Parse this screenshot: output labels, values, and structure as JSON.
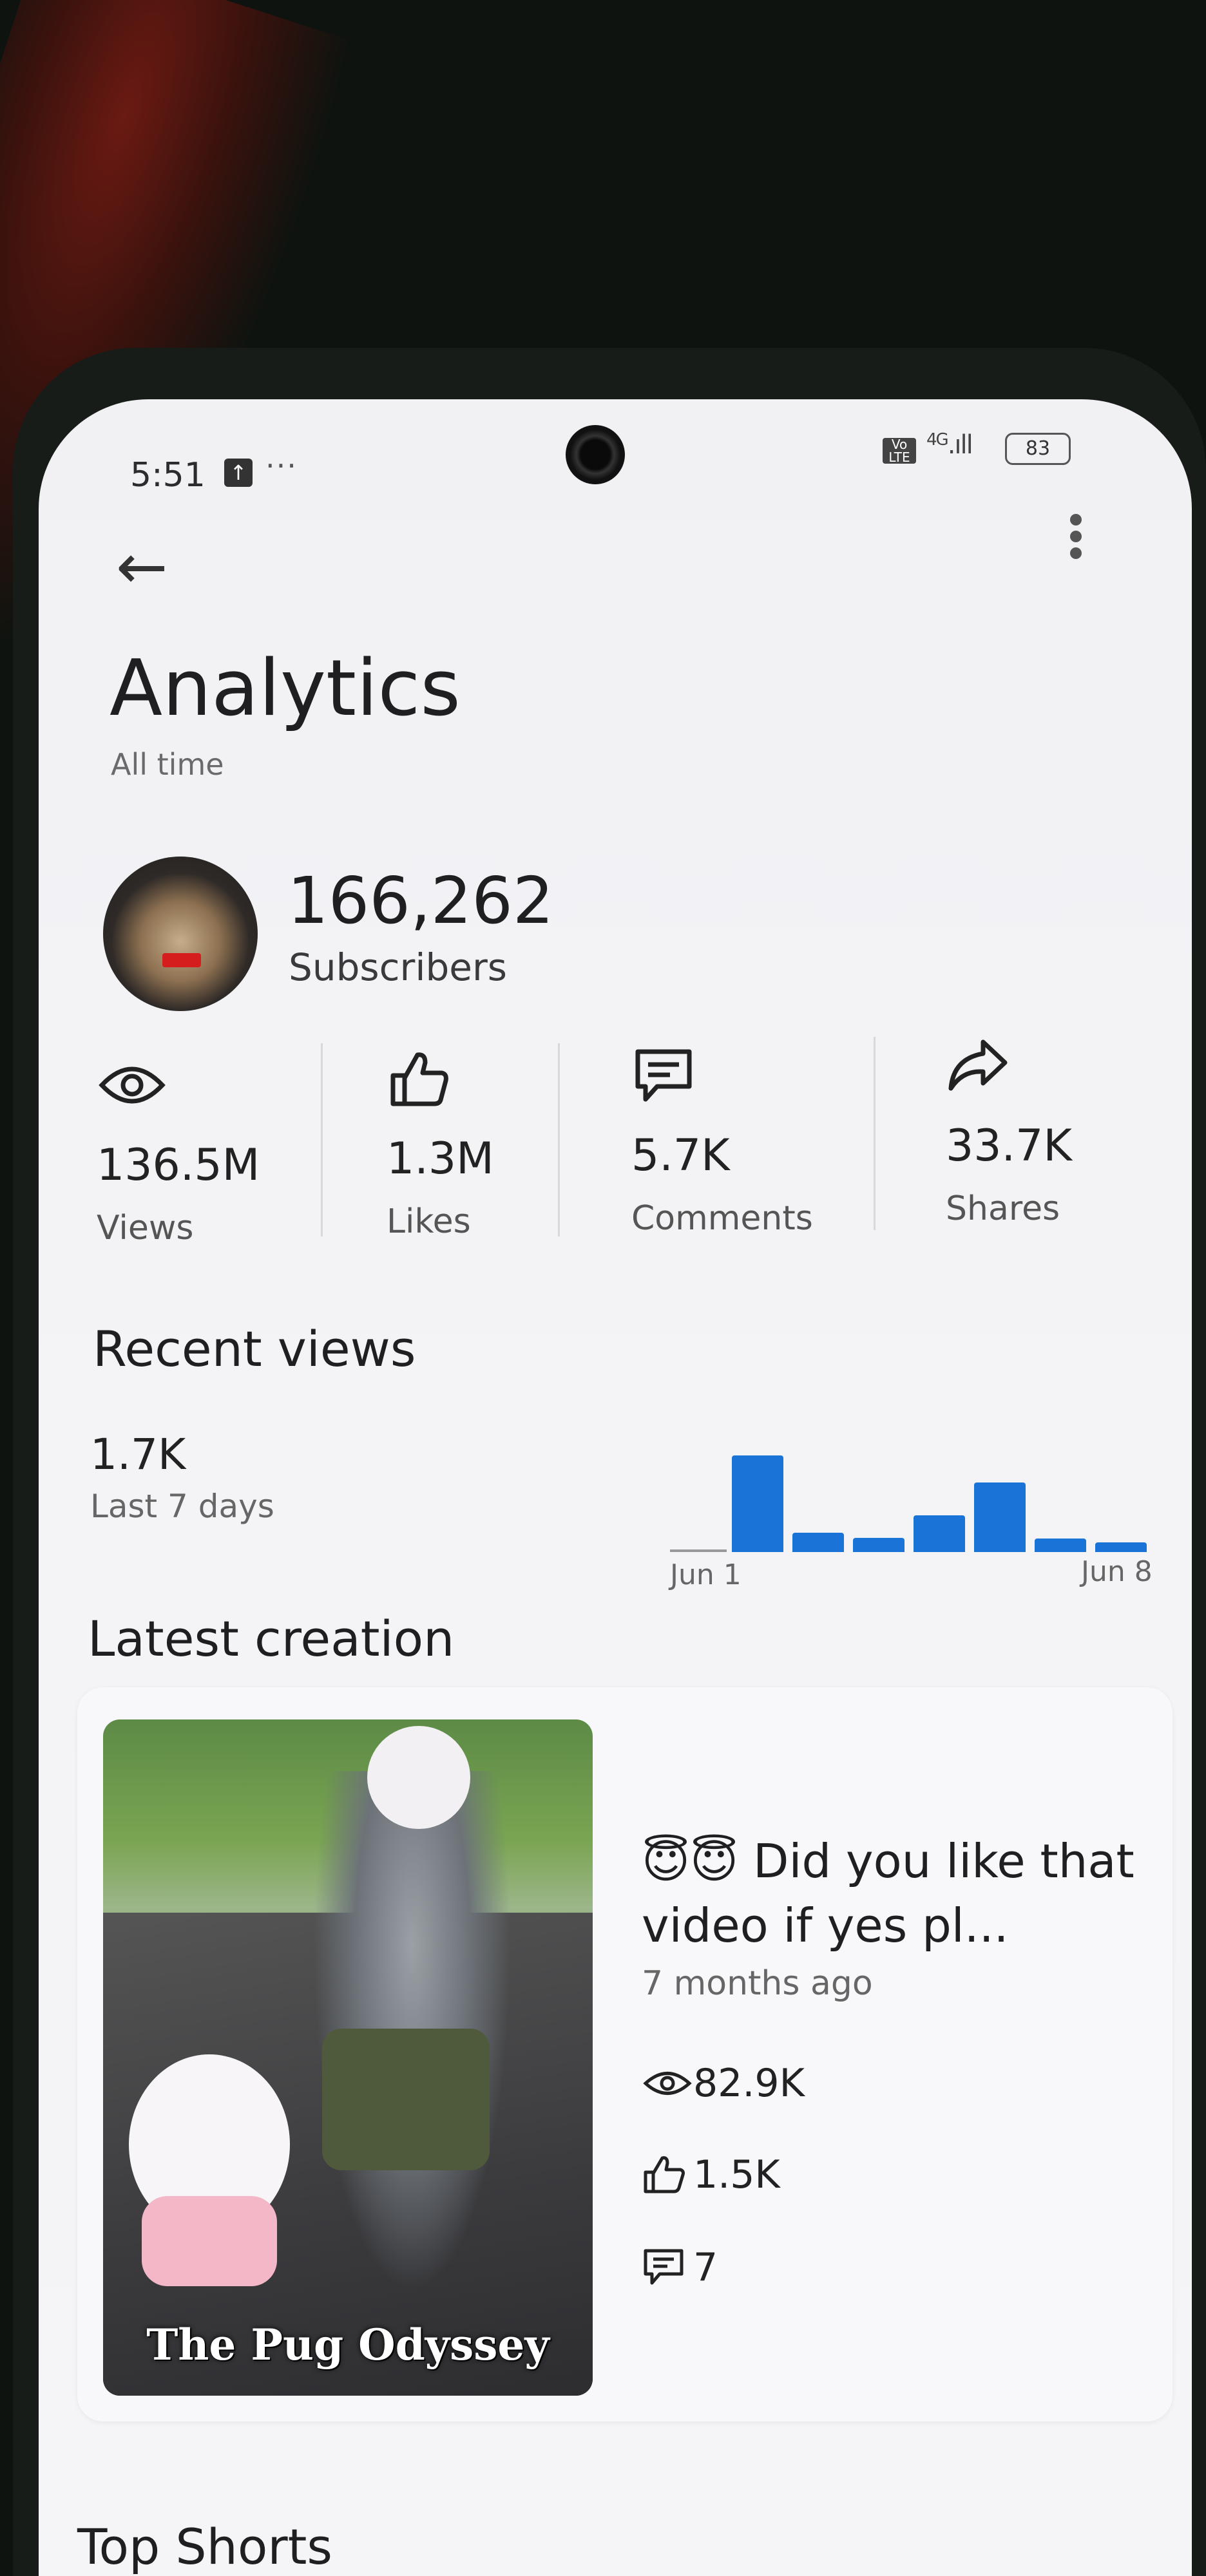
{
  "status_bar": {
    "time": "5:51",
    "upload_icon": "upload-icon",
    "more": "···",
    "volte": "VoLTE",
    "network": "4G",
    "battery": "83"
  },
  "header": {
    "back_icon": "back-arrow-icon",
    "menu_icon": "more-vert-icon",
    "title": "Analytics",
    "subtitle": "All time"
  },
  "channel": {
    "subscriber_count": "166,262",
    "subscriber_label": "Subscribers"
  },
  "stats": [
    {
      "icon": "eye-icon",
      "value": "136.5M",
      "label": "Views"
    },
    {
      "icon": "thumbs-up-icon",
      "value": "1.3M",
      "label": "Likes"
    },
    {
      "icon": "comment-icon",
      "value": "5.7K",
      "label": "Comments"
    },
    {
      "icon": "share-icon",
      "value": "33.7K",
      "label": "Shares"
    }
  ],
  "recent_views": {
    "title": "Recent views",
    "value": "1.7K",
    "period": "Last 7 days",
    "chart_data": {
      "type": "bar",
      "categories": [
        "Jun 1",
        "Jun 2",
        "Jun 3",
        "Jun 4",
        "Jun 5",
        "Jun 6",
        "Jun 7",
        "Jun 8"
      ],
      "values": [
        0,
        100,
        20,
        15,
        38,
        72,
        14,
        10
      ],
      "tick_labels": [
        "Jun 1",
        "Jun 8"
      ]
    },
    "accent_color": "#1a73d6"
  },
  "latest_creation": {
    "title": "Latest creation",
    "thumbnail_caption": "The Pug Odyssey",
    "video_title": "😇😇 Did you like that video if yes pl...",
    "age": "7 months ago",
    "views": "82.9K",
    "likes": "1.5K",
    "comments": "7"
  },
  "top_shorts": {
    "title": "Top Shorts"
  }
}
